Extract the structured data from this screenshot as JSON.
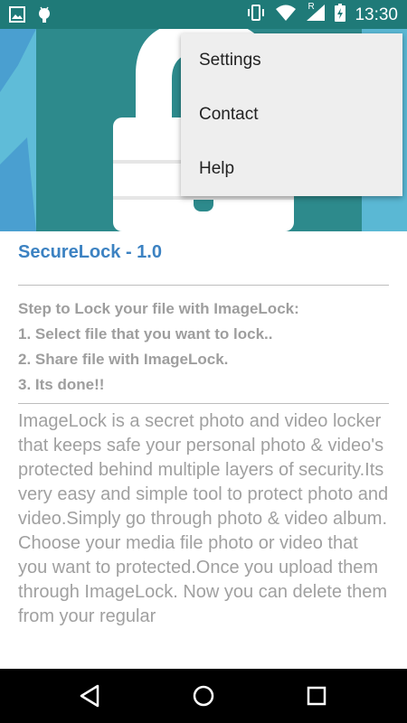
{
  "status_bar": {
    "time": "13:30",
    "left_icons": [
      "image-icon",
      "android-icon"
    ],
    "right_icons": [
      "vibrate-icon",
      "wifi-icon",
      "signal-icon",
      "battery-icon"
    ],
    "roaming_letter": "R",
    "bg_color": "#1f7a78"
  },
  "overflow_menu": {
    "items": [
      {
        "label": "Settings"
      },
      {
        "label": "Contact"
      },
      {
        "label": "Help"
      }
    ]
  },
  "main": {
    "app_title": "SecureLock - 1.0",
    "steps_heading": "Step to Lock your file with ImageLock:",
    "steps": [
      "1. Select file that you want to lock..",
      "2. Share file with ImageLock.",
      "3. Its done!!"
    ],
    "description_1": "ImageLock is a secret photo and video locker that keeps safe your personal photo & video's protected behind multiple layers of security.Its very easy and simple tool to protect photo and video.Simply go through photo & video album.",
    "description_2": "Choose your media file photo or video that you want to protected.Once you upload them through ImageLock. Now you can delete them from your regular",
    "title_color": "#3c82c2",
    "text_color": "#9e9e9e"
  },
  "nav_bar": {
    "icons": [
      "back-icon",
      "home-icon",
      "recents-icon"
    ]
  }
}
